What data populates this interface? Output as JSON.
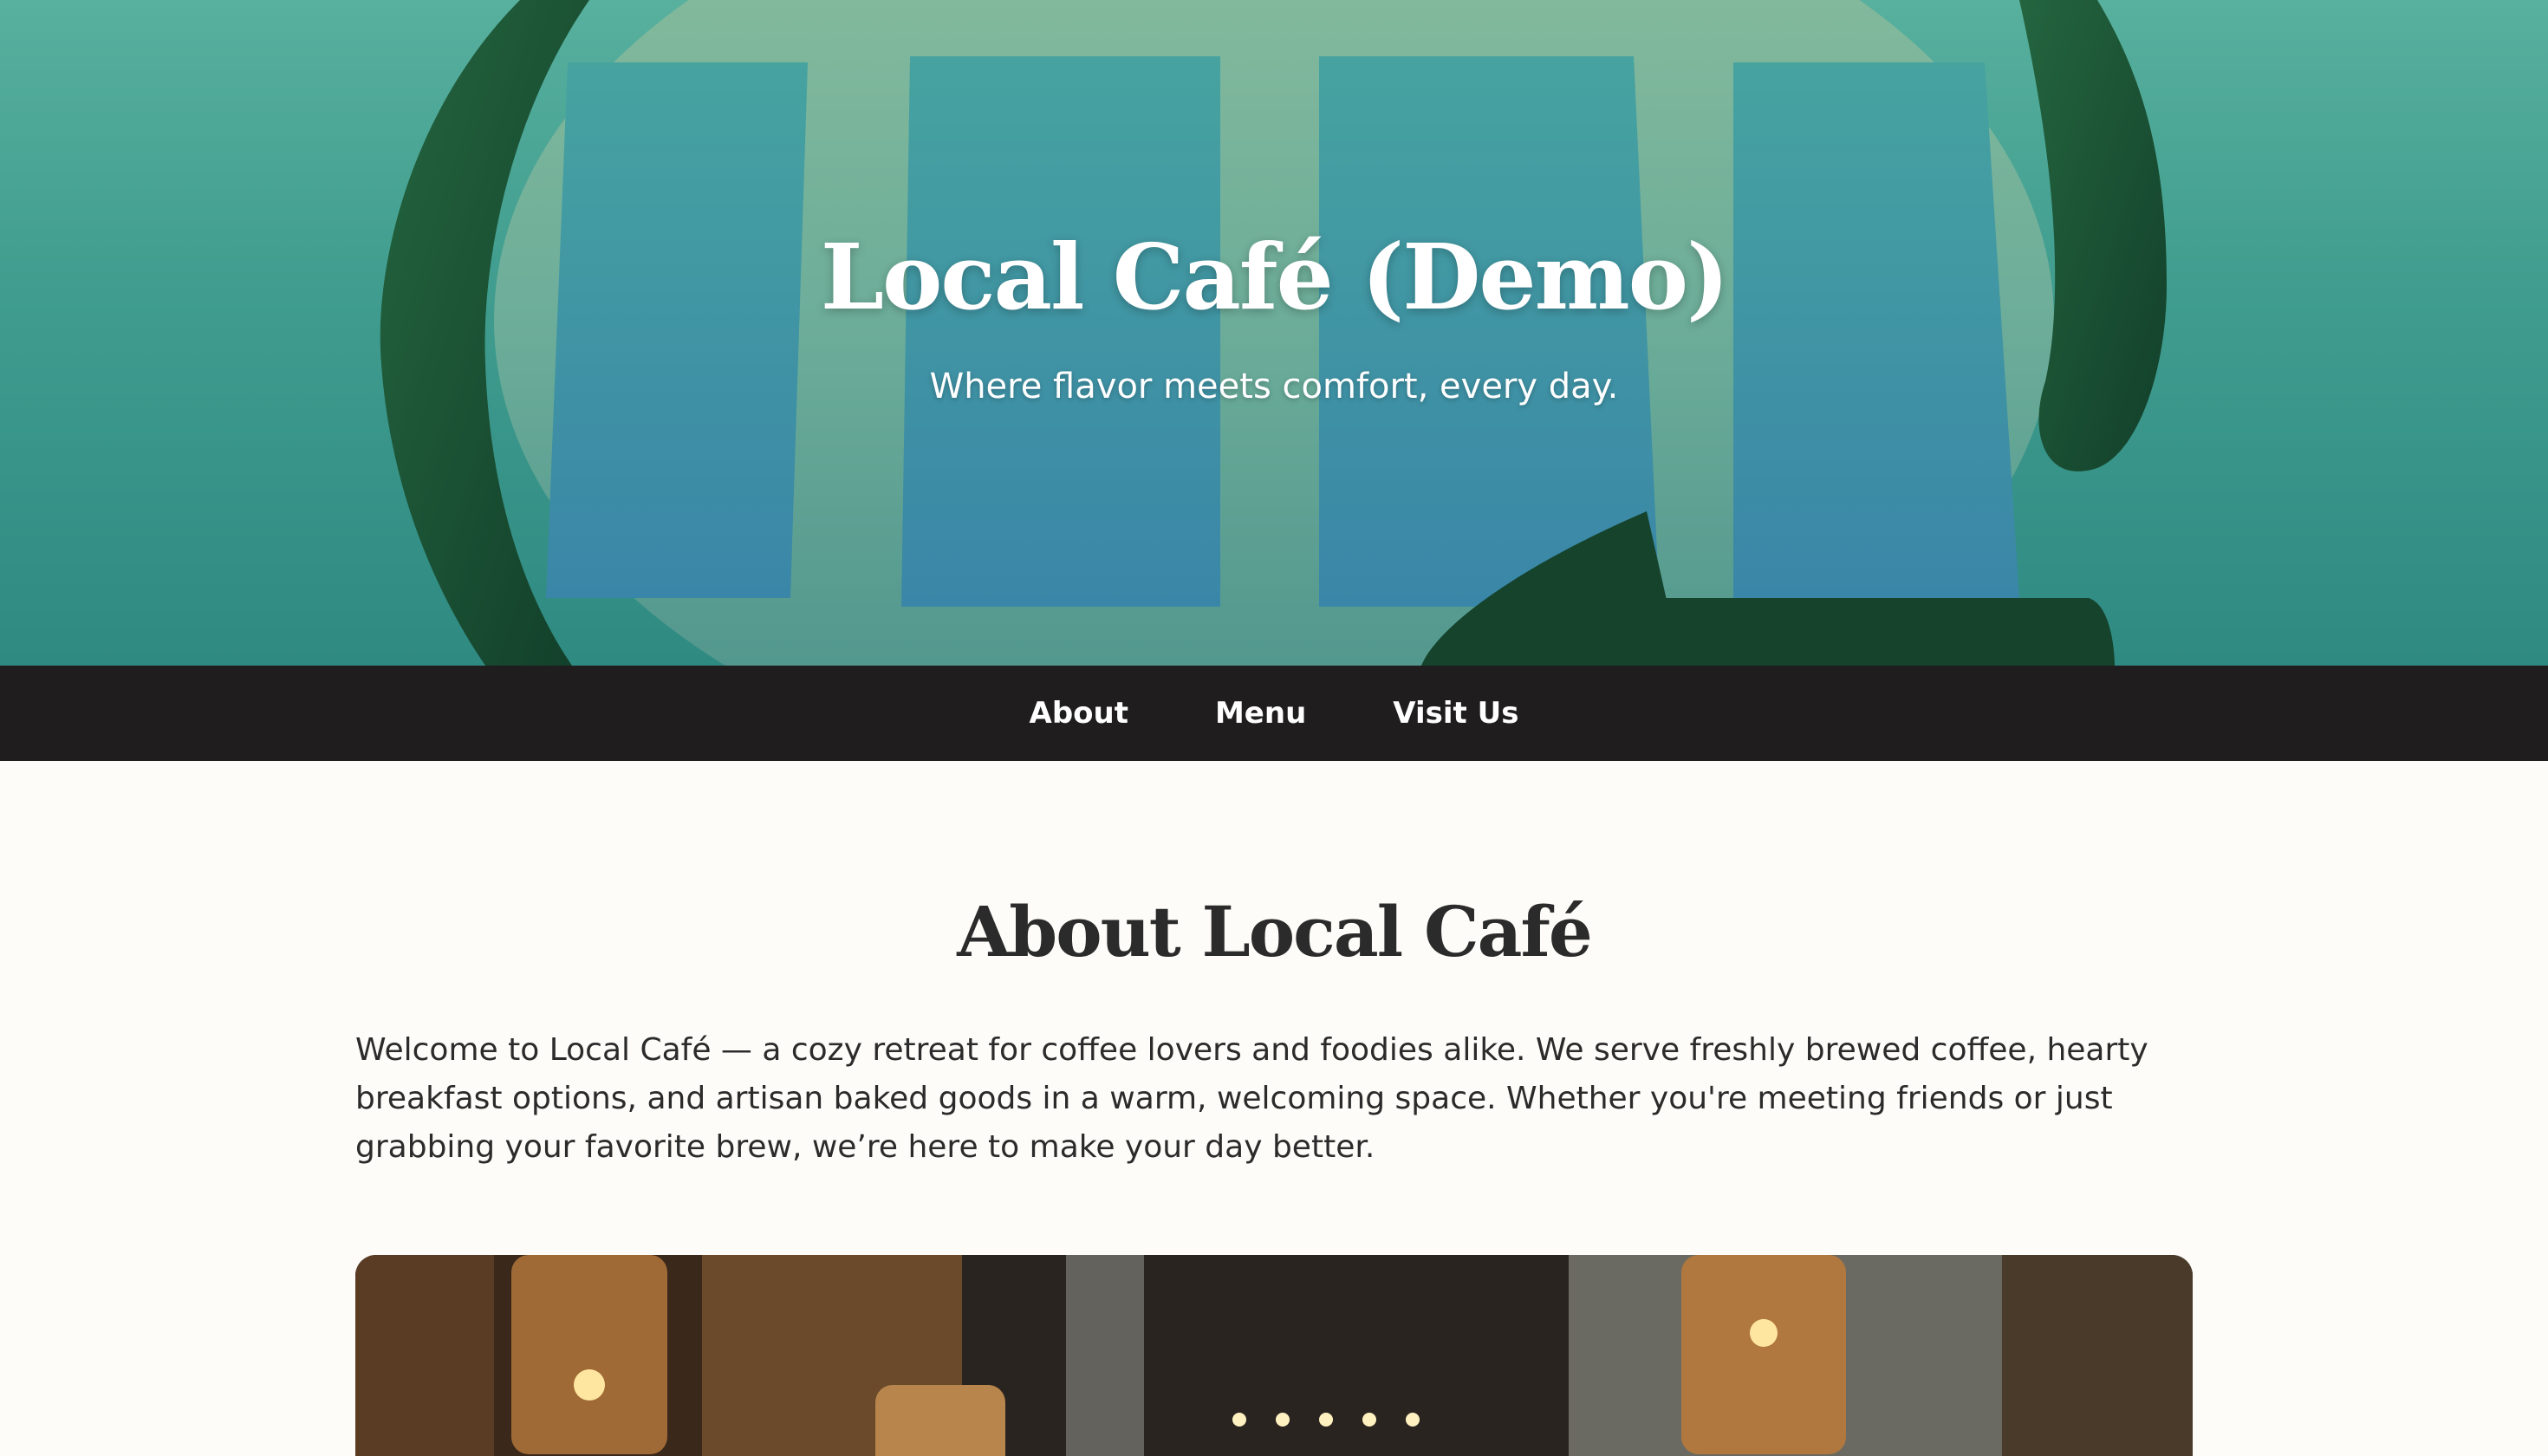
{
  "hero": {
    "title": "Local Café (Demo)",
    "tagline": "Where flavor meets comfort, every day.",
    "graphic_icon": "refresh-window-icon"
  },
  "nav": {
    "items": [
      {
        "label": "About"
      },
      {
        "label": "Menu"
      },
      {
        "label": "Visit Us"
      }
    ]
  },
  "about": {
    "title": "About Local Café",
    "body": "Welcome to Local Café — a cozy retreat for coffee lovers and foodies alike. We serve freshly brewed coffee, hearty breakfast options, and artisan baked goods in a warm, welcoming space. Whether you're meeting friends or just grabbing your favorite brew, we’re here to make your day better."
  },
  "colors": {
    "hero_teal": "#45a696",
    "nav_bg": "#1f1d1e",
    "page_bg": "#fdfcf8",
    "text": "#2b2b2b",
    "ring_green": "#1d5a3a"
  }
}
